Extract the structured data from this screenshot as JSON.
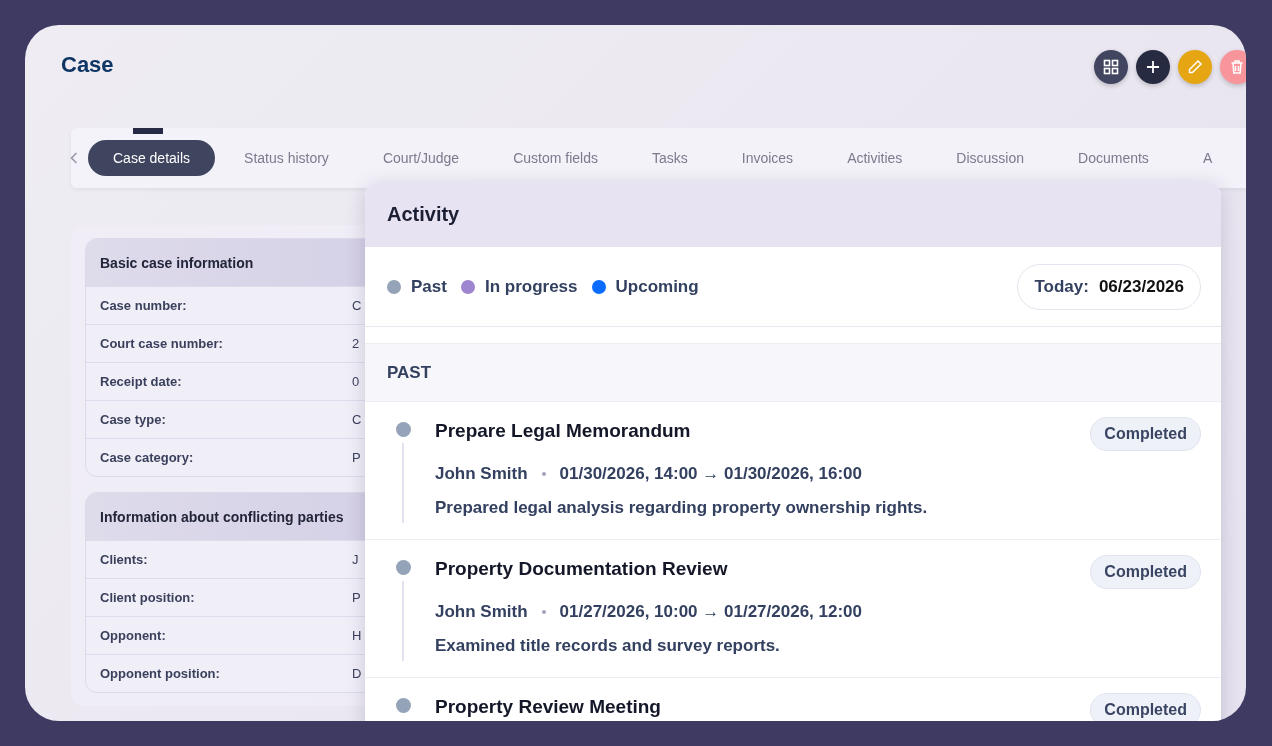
{
  "page": {
    "title": "Case"
  },
  "actions": [
    {
      "kind": "grid"
    },
    {
      "kind": "add"
    },
    {
      "kind": "edit"
    },
    {
      "kind": "delete"
    }
  ],
  "tabs": [
    {
      "label": "Case details",
      "selected": true
    },
    {
      "label": "Status history",
      "selected": false
    },
    {
      "label": "Court/Judge",
      "selected": false
    },
    {
      "label": "Custom fields",
      "selected": false
    },
    {
      "label": "Tasks",
      "selected": false
    },
    {
      "label": "Invoices",
      "selected": false
    },
    {
      "label": "Activities",
      "selected": false
    },
    {
      "label": "Discussion",
      "selected": false
    },
    {
      "label": "Documents",
      "selected": false
    },
    {
      "label": "A",
      "selected": false
    }
  ],
  "sections": [
    {
      "title": "Basic case information",
      "rows": [
        {
          "label": "Case number:",
          "value": "C"
        },
        {
          "label": "Court case number:",
          "value": "2"
        },
        {
          "label": "Receipt date:",
          "value": "0"
        },
        {
          "label": "Case type:",
          "value": "C"
        },
        {
          "label": "Case category:",
          "value": "P"
        }
      ]
    },
    {
      "title": "Information about conflicting parties",
      "rows": [
        {
          "label": "Clients:",
          "value": "J"
        },
        {
          "label": "Client position:",
          "value": "P"
        },
        {
          "label": "Opponent:",
          "value": "H"
        },
        {
          "label": "Opponent position:",
          "value": "D"
        }
      ]
    }
  ],
  "activity": {
    "title": "Activity",
    "legend": [
      {
        "label": "Past",
        "color": "#94a3b8"
      },
      {
        "label": "In progress",
        "color": "#9d85cf"
      },
      {
        "label": "Upcoming",
        "color": "#0b6cff"
      }
    ],
    "today_label": "Today:",
    "today": "06/23/2026",
    "group": "PAST",
    "items": [
      {
        "title": "Prepare Legal Memorandum",
        "status": "Completed",
        "person": "John Smith",
        "time": "01/30/2026, 14:00 → 01/30/2026, 16:00",
        "description": "Prepared legal analysis regarding property ownership rights."
      },
      {
        "title": "Property Documentation Review",
        "status": "Completed",
        "person": "John Smith",
        "time": "01/27/2026, 10:00 → 01/27/2026, 12:00",
        "description": "Examined title records and survey reports."
      },
      {
        "title": "Property Review Meeting",
        "status": "Completed"
      }
    ]
  }
}
